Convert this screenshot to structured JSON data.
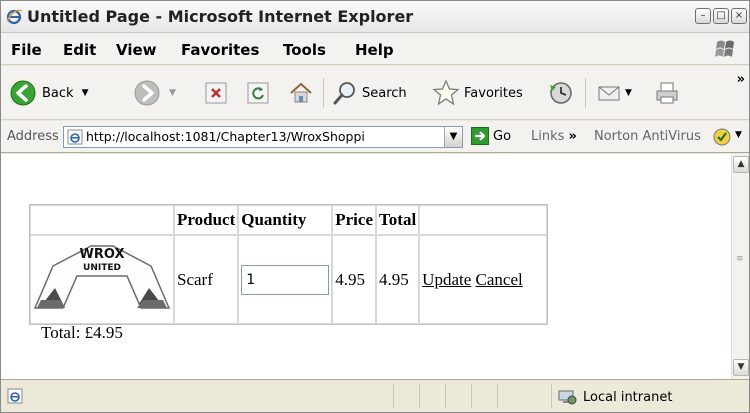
{
  "window": {
    "title": "Untitled Page - Microsoft Internet Explorer"
  },
  "menu": [
    "File",
    "Edit",
    "View",
    "Favorites",
    "Tools",
    "Help"
  ],
  "toolbar": {
    "back": "Back",
    "search": "Search",
    "favorites": "Favorites"
  },
  "address": {
    "label": "Address",
    "url": "http://localhost:1081/Chapter13/WroxShoppi",
    "go": "Go",
    "links": "Links",
    "norton": "Norton AntiVirus"
  },
  "cart": {
    "headers": [
      "Product",
      "Quantity",
      "Price",
      "Total"
    ],
    "row": {
      "logo_text_1": "WROX",
      "logo_text_2": "UNITED",
      "product": "Scarf",
      "quantity": "1",
      "price": "4.95",
      "total": "4.95",
      "update": "Update",
      "cancel": "Cancel"
    },
    "grand_total": "Total: £4.95"
  },
  "status": {
    "zone": "Local intranet"
  },
  "colors": {
    "back_green": "#3aa335",
    "go_green": "#2f9a2f",
    "address_border": "#7f9db9"
  }
}
